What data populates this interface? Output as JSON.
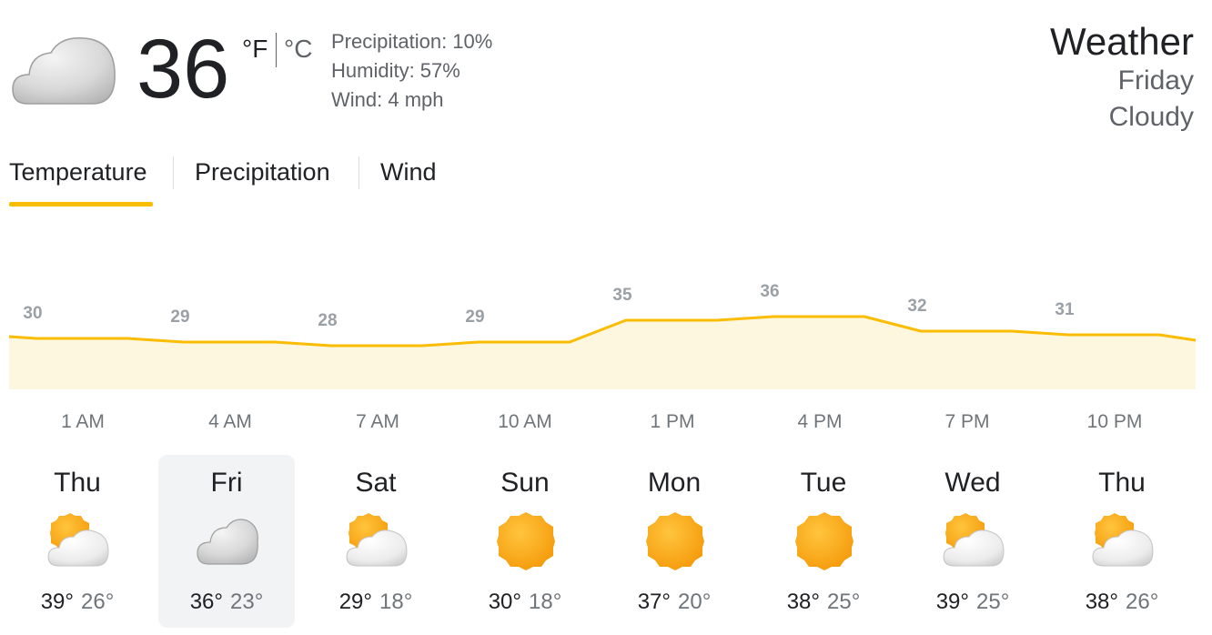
{
  "current": {
    "temp": "36",
    "unit_f": "°F",
    "unit_c": "°C",
    "precipitation": "Precipitation: 10%",
    "humidity": "Humidity: 57%",
    "wind": "Wind: 4 mph",
    "icon": "cloud-icon"
  },
  "header": {
    "title": "Weather",
    "day": "Friday",
    "condition": "Cloudy"
  },
  "tabs": [
    {
      "label": "Temperature",
      "active": true
    },
    {
      "label": "Precipitation",
      "active": false
    },
    {
      "label": "Wind",
      "active": false
    }
  ],
  "chart_data": {
    "type": "area",
    "x": [
      "1 AM",
      "4 AM",
      "7 AM",
      "10 AM",
      "1 PM",
      "4 PM",
      "7 PM",
      "10 PM"
    ],
    "values": [
      30,
      29,
      28,
      29,
      35,
      36,
      32,
      31
    ],
    "line_color": "#fbbc04",
    "fill_color": "#fef7e0"
  },
  "days": [
    {
      "name": "Thu",
      "hi": "39°",
      "lo": "26°",
      "icon": "partly-cloudy-icon"
    },
    {
      "name": "Fri",
      "hi": "36°",
      "lo": "23°",
      "icon": "cloud-icon",
      "selected": true
    },
    {
      "name": "Sat",
      "hi": "29°",
      "lo": "18°",
      "icon": "partly-cloudy-icon"
    },
    {
      "name": "Sun",
      "hi": "30°",
      "lo": "18°",
      "icon": "sun-icon"
    },
    {
      "name": "Mon",
      "hi": "37°",
      "lo": "20°",
      "icon": "sun-icon"
    },
    {
      "name": "Tue",
      "hi": "38°",
      "lo": "25°",
      "icon": "sun-icon"
    },
    {
      "name": "Wed",
      "hi": "39°",
      "lo": "25°",
      "icon": "partly-cloudy-icon"
    },
    {
      "name": "Thu",
      "hi": "38°",
      "lo": "26°",
      "icon": "partly-cloudy-icon"
    }
  ]
}
